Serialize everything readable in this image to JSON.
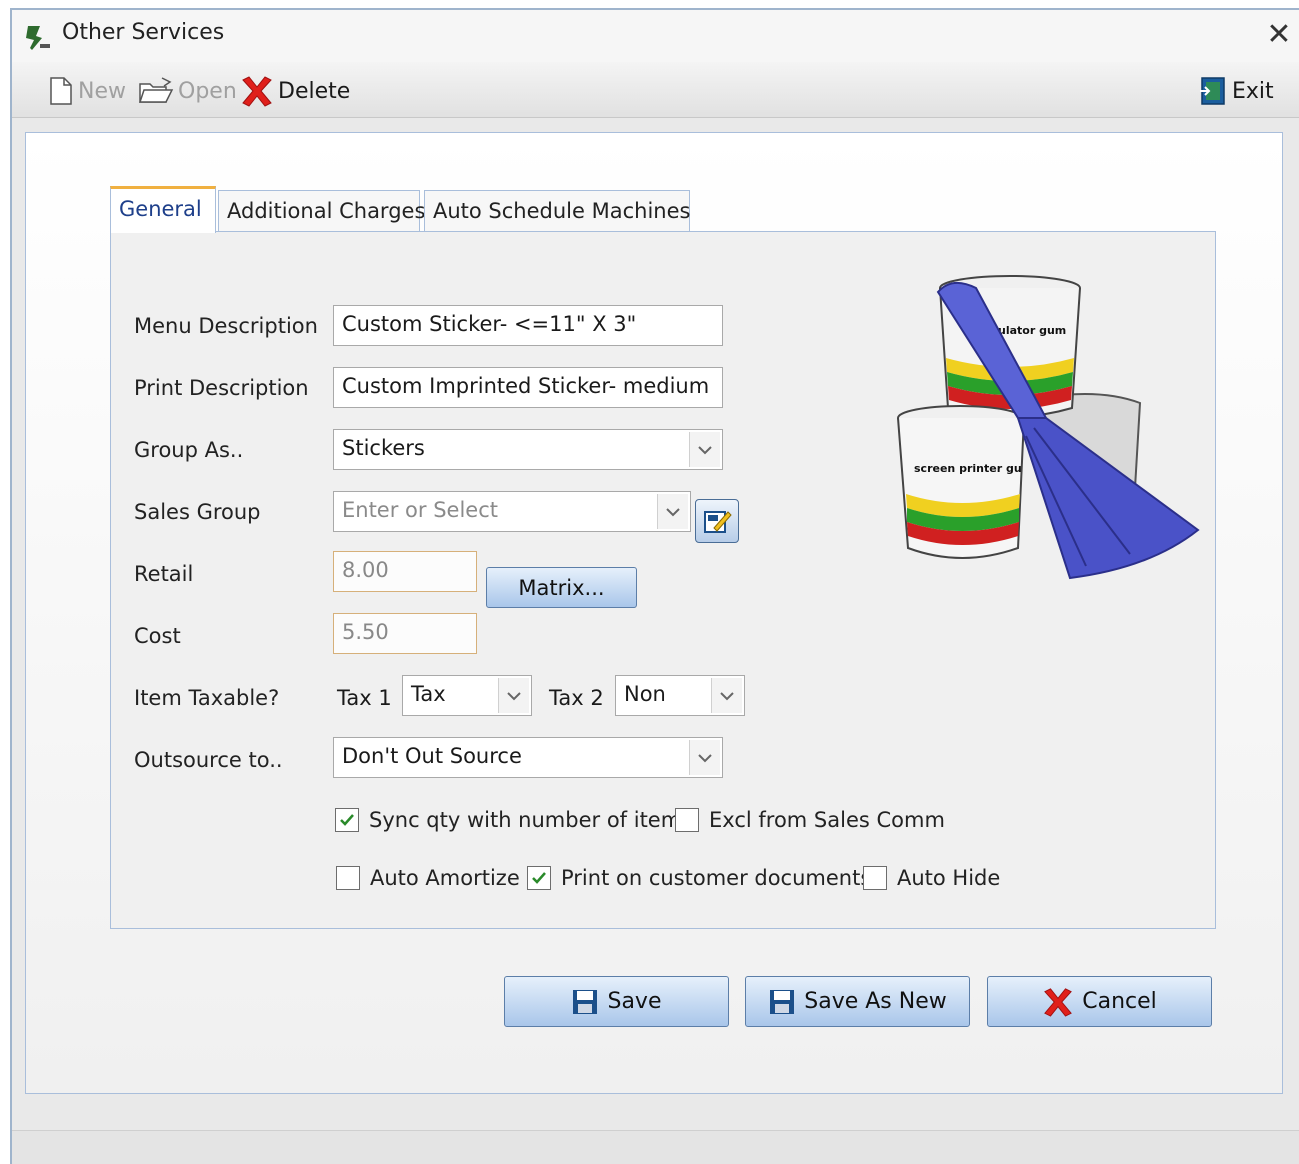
{
  "window": {
    "title": "Other Services"
  },
  "toolbar": {
    "new_label": "New",
    "open_label": "Open",
    "delete_label": "Delete",
    "exit_label": "Exit"
  },
  "tabs": [
    {
      "label": "General",
      "active": true
    },
    {
      "label": "Additional Charges",
      "active": false
    },
    {
      "label": "Auto Schedule Machines",
      "active": false
    }
  ],
  "form": {
    "menu_description": {
      "label": "Menu Description",
      "value": "Custom Sticker- <=11\" X 3\""
    },
    "print_description": {
      "label": "Print Description",
      "value": "Custom Imprinted Sticker- medium"
    },
    "group_as": {
      "label": "Group As..",
      "value": "Stickers"
    },
    "sales_group": {
      "label": "Sales Group",
      "placeholder": "Enter or Select"
    },
    "retail": {
      "label": "Retail",
      "value": "8.00"
    },
    "matrix_button": "Matrix...",
    "cost": {
      "label": "Cost",
      "value": "5.50"
    },
    "item_taxable": {
      "label": "Item Taxable?",
      "tax1_label": "Tax 1",
      "tax1_value": "Tax",
      "tax2_label": "Tax 2",
      "tax2_value": "Non"
    },
    "outsource": {
      "label": "Outsource to..",
      "value": "Don't Out Source"
    },
    "checkboxes": {
      "sync_qty": {
        "label": "Sync qty with number of items",
        "checked": true
      },
      "excl_sales_comm": {
        "label": "Excl from Sales Comm",
        "checked": false
      },
      "auto_amortize": {
        "label": "Auto Amortize",
        "checked": false
      },
      "print_on_docs": {
        "label": "Print on customer documents",
        "checked": true
      },
      "auto_hide": {
        "label": "Auto Hide",
        "checked": false
      }
    }
  },
  "illustration": {
    "bucket_top_text": "ulator gum",
    "bucket_bottom_text": "screen printer gu"
  },
  "actions": {
    "save_label": "Save",
    "save_as_new_label": "Save As New",
    "cancel_label": "Cancel"
  },
  "colors": {
    "accent_blue": "#1e3f8a",
    "button_blue": "#a9c6ea",
    "delete_red": "#e0201b",
    "tab_highlight": "#f0b040"
  },
  "icons": [
    "app-icon",
    "close-icon",
    "new-doc-icon",
    "open-folder-icon",
    "delete-x-icon",
    "exit-door-icon",
    "dropdown-arrow-icon",
    "edit-icon",
    "floppy-save-icon",
    "cancel-x-icon",
    "checkmark-icon"
  ]
}
